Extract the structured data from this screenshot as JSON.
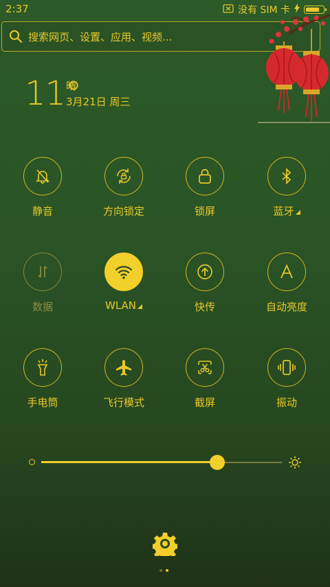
{
  "status_bar": {
    "time": "2:37",
    "sim_text": "没有 SIM 卡",
    "battery_level": 0.85
  },
  "search": {
    "placeholder": "搜索网页、设置、应用、视频..."
  },
  "weather": {
    "temperature": "11°",
    "condition": "晴",
    "date": "3月21日 周三"
  },
  "toggles": [
    {
      "label": "静音",
      "icon": "bell-off-icon",
      "active": false,
      "enabled": true,
      "arrow": false
    },
    {
      "label": "方向锁定",
      "icon": "rotation-lock-icon",
      "active": false,
      "enabled": true,
      "arrow": false
    },
    {
      "label": "锁屏",
      "icon": "lock-icon",
      "active": false,
      "enabled": true,
      "arrow": false
    },
    {
      "label": "蓝牙",
      "icon": "bluetooth-icon",
      "active": false,
      "enabled": true,
      "arrow": true
    },
    {
      "label": "数据",
      "icon": "data-arrows-icon",
      "active": false,
      "enabled": false,
      "arrow": false
    },
    {
      "label": "WLAN",
      "icon": "wifi-icon",
      "active": true,
      "enabled": true,
      "arrow": true
    },
    {
      "label": "快传",
      "icon": "upload-circle-icon",
      "active": false,
      "enabled": true,
      "arrow": false
    },
    {
      "label": "自动亮度",
      "icon": "auto-brightness-icon",
      "active": false,
      "enabled": true,
      "arrow": false
    },
    {
      "label": "手电筒",
      "icon": "flashlight-icon",
      "active": false,
      "enabled": true,
      "arrow": false
    },
    {
      "label": "飞行模式",
      "icon": "airplane-icon",
      "active": false,
      "enabled": true,
      "arrow": false
    },
    {
      "label": "截屏",
      "icon": "screenshot-scissors-icon",
      "active": false,
      "enabled": true,
      "arrow": false
    },
    {
      "label": "振动",
      "icon": "vibrate-icon",
      "active": false,
      "enabled": true,
      "arrow": false
    }
  ],
  "brightness": {
    "level": 0.73
  },
  "pager": {
    "pages": 2,
    "current": 1
  },
  "colors": {
    "accent": "#f2cf2a",
    "background": "#2a5426"
  }
}
